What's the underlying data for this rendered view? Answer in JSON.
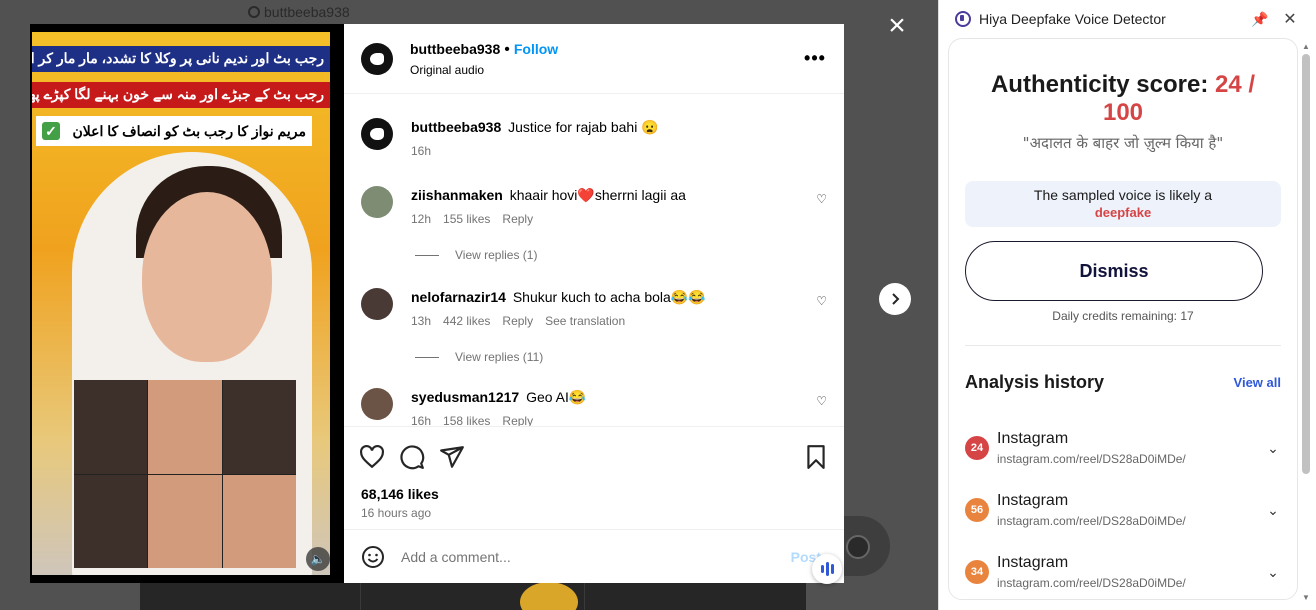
{
  "background": {
    "username": "buttbeeba938"
  },
  "video": {
    "banner_top": "رجب بٹ اور ندیم نانی پر وکلا کا تشدد، مار مار کر ادھ موا کر دیا",
    "banner_middle": "رجب بٹ کے جبڑے اور منہ سے خون بہنے لگا کپڑے پھاڑ دیے",
    "banner_white": "مریم نواز کا رجب بٹ کو انصاف کا اعلان"
  },
  "post": {
    "author": "buttbeeba938",
    "follow_label": "Follow",
    "audio": "Original audio",
    "caption_author": "buttbeeba938",
    "caption_text": "Justice for rajab bahi 😦",
    "caption_time": "16h",
    "comments": [
      {
        "user": "ziishanmaken",
        "text": "khaair hovi❤️sherrni lagii aa",
        "time": "12h",
        "likes": "155 likes",
        "reply": "Reply",
        "extra": "",
        "view_replies": "View replies (1)"
      },
      {
        "user": "nelofarnazir14",
        "text": "Shukur kuch to acha bola😂😂",
        "time": "13h",
        "likes": "442 likes",
        "reply": "Reply",
        "extra": "See translation",
        "view_replies": "View replies (11)"
      },
      {
        "user": "syedusman1217",
        "text": "Geo AI😂",
        "time": "16h",
        "likes": "158 likes",
        "reply": "Reply",
        "extra": "",
        "view_replies": ""
      }
    ],
    "likes": "68,146 likes",
    "time_ago": "16 hours ago",
    "comment_placeholder": "Add a comment...",
    "post_label": "Post"
  },
  "extension": {
    "title": "Hiya Deepfake Voice Detector",
    "score_label": "Authenticity score: ",
    "score_value": "24 / 100",
    "quote": "\"अदालत के बाहर जो ज़ुल्म किया है\"",
    "verdict_text": "The sampled voice is likely a",
    "verdict_value": "deepfake",
    "dismiss_label": "Dismiss",
    "credits": "Daily credits remaining: 17",
    "history_title": "Analysis history",
    "view_all": "View all",
    "history": [
      {
        "score": "24",
        "color": "#d64545",
        "name": "Instagram",
        "url": "instagram.com/reel/DS28aD0iMDe/"
      },
      {
        "score": "56",
        "color": "#e8843e",
        "name": "Instagram",
        "url": "instagram.com/reel/DS28aD0iMDe/"
      },
      {
        "score": "34",
        "color": "#e8843e",
        "name": "Instagram",
        "url": "instagram.com/reel/DS28aD0iMDe/"
      }
    ]
  }
}
